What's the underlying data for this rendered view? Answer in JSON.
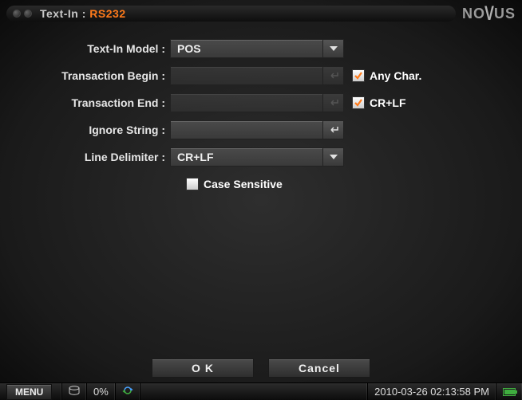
{
  "title": {
    "prefix": "Text-In : ",
    "value": "RS232"
  },
  "brand": "NOVUS",
  "form": {
    "model_label": "Text-In Model :",
    "model_value": "POS",
    "tbegin_label": "Transaction Begin :",
    "tbegin_value": "",
    "anychar_label": "Any Char.",
    "anychar_checked": true,
    "tend_label": "Transaction End :",
    "tend_value": "",
    "crlf_label": "CR+LF",
    "crlf_checked": true,
    "ignore_label": "Ignore String :",
    "ignore_value": "",
    "delim_label": "Line Delimiter :",
    "delim_value": "CR+LF",
    "case_label": "Case Sensitive",
    "case_checked": false
  },
  "buttons": {
    "ok": "O K",
    "cancel": "Cancel"
  },
  "status": {
    "menu": "MENU",
    "disk_pct": "0%",
    "datetime": "2010-03-26 02:13:58 PM"
  }
}
